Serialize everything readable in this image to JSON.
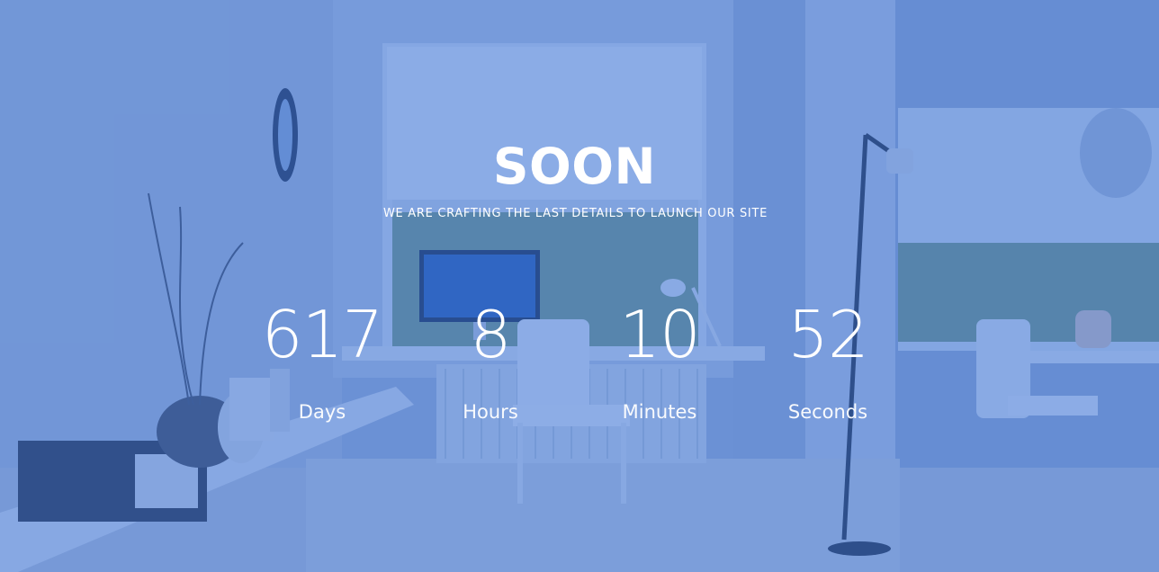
{
  "page": {
    "title": "SOON",
    "subtitle": "WE ARE CRAFTING THE LAST DETAILS TO LAUNCH OUR SITE"
  },
  "countdown": {
    "days": {
      "value": "617",
      "label": "Days"
    },
    "hours": {
      "value": "8",
      "label": "Hours"
    },
    "minutes": {
      "value": "10",
      "label": "Minutes"
    },
    "seconds": {
      "value": "52",
      "label": "Seconds"
    }
  },
  "colors": {
    "overlay_tint": "#3c74d6",
    "text": "#ffffff"
  }
}
